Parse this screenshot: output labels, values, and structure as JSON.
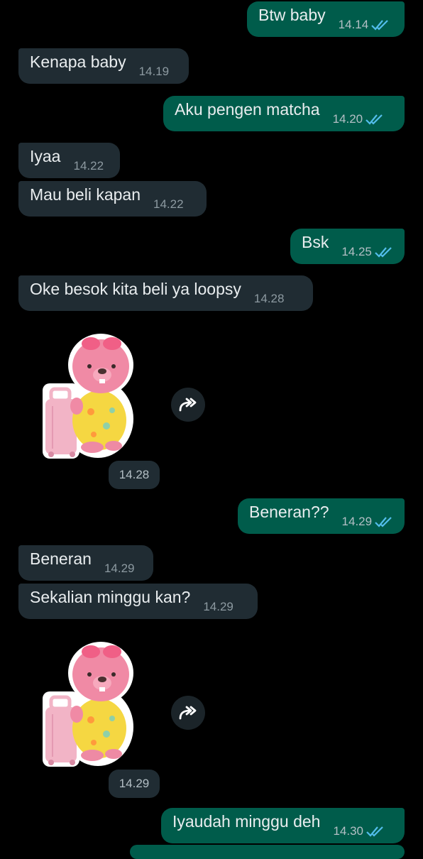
{
  "colors": {
    "outgoing_bubble": "#005c4b",
    "incoming_bubble": "#202c33",
    "background": "#000000",
    "read_ticks": "#53bdeb"
  },
  "messages": [
    {
      "text": "Btw baby",
      "time": "14.14",
      "dir": "out",
      "read": true
    },
    {
      "text": "Kenapa baby",
      "time": "14.19",
      "dir": "in"
    },
    {
      "text": "Aku pengen matcha",
      "time": "14.20",
      "dir": "out",
      "read": true
    },
    {
      "text": "Iyaa",
      "time": "14.22",
      "dir": "in"
    },
    {
      "text": "Mau beli kapan",
      "time": "14.22",
      "dir": "in"
    },
    {
      "text": "Bsk",
      "time": "14.25",
      "dir": "out",
      "read": true
    },
    {
      "text": "Oke besok kita beli ya loopsy",
      "time": "14.28",
      "dir": "in"
    },
    {
      "text": "Beneran??",
      "time": "14.29",
      "dir": "out",
      "read": true
    },
    {
      "text": "Beneran",
      "time": "14.29",
      "dir": "in"
    },
    {
      "text": "Sekalian minggu kan?",
      "time": "14.29",
      "dir": "in"
    },
    {
      "text": "Iyaudah minggu deh",
      "time": "14.30",
      "dir": "out",
      "read": true
    }
  ],
  "stickers": [
    {
      "name": "loopy-sticker",
      "time": "14.28",
      "icon": "forward-icon"
    },
    {
      "name": "loopy-sticker",
      "time": "14.29",
      "icon": "forward-icon"
    }
  ]
}
